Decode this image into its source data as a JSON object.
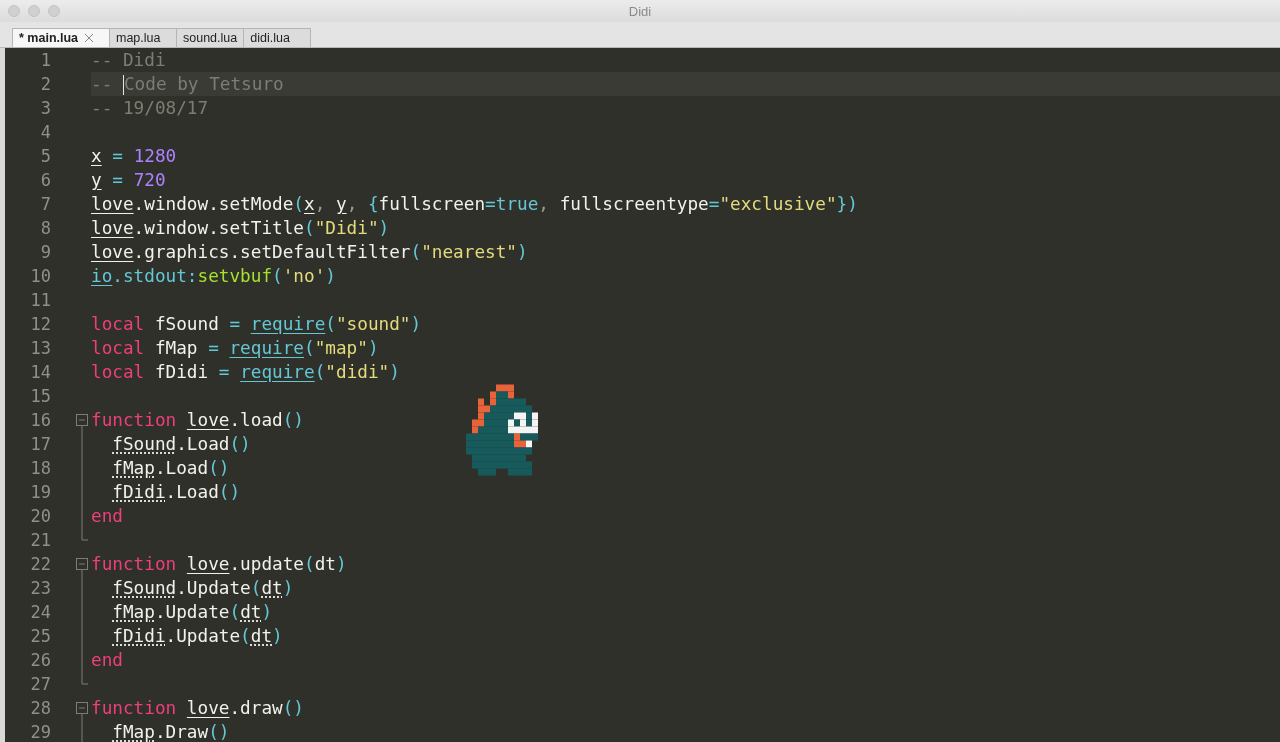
{
  "window": {
    "title": "Didi"
  },
  "tabs": [
    {
      "label": "* main.lua",
      "selected": true
    },
    {
      "label": "map.lua",
      "selected": false
    },
    {
      "label": "sound.lua",
      "selected": false
    },
    {
      "label": "didi.lua",
      "selected": false
    }
  ],
  "lines": [
    {
      "number": "1",
      "tokens": [
        {
          "text": "-- Didi",
          "kind": "comment"
        }
      ]
    },
    {
      "number": "2",
      "current": true,
      "tokens": [
        {
          "text": "-- ",
          "kind": "comment"
        },
        {
          "text": "Code by Tetsuro",
          "kind": "comment",
          "caret_before": true
        }
      ]
    },
    {
      "number": "3",
      "tokens": [
        {
          "text": "-- 19/08/17",
          "kind": "comment"
        }
      ]
    },
    {
      "number": "4"
    },
    {
      "number": "5",
      "tokens": [
        {
          "text": "x",
          "kind": "var"
        },
        {
          "text": " = ",
          "kind": "op"
        },
        {
          "text": "1280",
          "kind": "number"
        }
      ]
    },
    {
      "number": "6",
      "tokens": [
        {
          "text": "y",
          "kind": "var"
        },
        {
          "text": " = ",
          "kind": "op"
        },
        {
          "text": "720",
          "kind": "number"
        }
      ]
    },
    {
      "number": "7",
      "tokens": [
        {
          "text": "love",
          "kind": "var"
        },
        {
          "text": ".window.setMode",
          "kind": "plain"
        },
        {
          "text": "(",
          "kind": "op"
        },
        {
          "text": "x",
          "kind": "var"
        },
        {
          "text": ", ",
          "kind": "punct"
        },
        {
          "text": "y",
          "kind": "var"
        },
        {
          "text": ", ",
          "kind": "punct"
        },
        {
          "text": "{",
          "kind": "op"
        },
        {
          "text": "fullscreen",
          "kind": "plain"
        },
        {
          "text": "=true",
          "kind": "op"
        },
        {
          "text": ", ",
          "kind": "punct"
        },
        {
          "text": "fullscreentype",
          "kind": "plain"
        },
        {
          "text": "=",
          "kind": "op"
        },
        {
          "text": "\"exclusive\"",
          "kind": "string"
        },
        {
          "text": "})",
          "kind": "op"
        }
      ]
    },
    {
      "number": "8",
      "tokens": [
        {
          "text": "love",
          "kind": "var"
        },
        {
          "text": ".window.setTitle",
          "kind": "plain"
        },
        {
          "text": "(",
          "kind": "op"
        },
        {
          "text": "\"Didi\"",
          "kind": "string"
        },
        {
          "text": ")",
          "kind": "op"
        }
      ]
    },
    {
      "number": "9",
      "tokens": [
        {
          "text": "love",
          "kind": "var"
        },
        {
          "text": ".graphics.setDefaultFilter",
          "kind": "plain"
        },
        {
          "text": "(",
          "kind": "op"
        },
        {
          "text": "\"nearest\"",
          "kind": "string"
        },
        {
          "text": ")",
          "kind": "op"
        }
      ]
    },
    {
      "number": "10",
      "tokens": [
        {
          "text": "io",
          "kind": "builtin"
        },
        {
          "text": ".stdout:",
          "kind": "op"
        },
        {
          "text": "setvbuf",
          "kind": "method"
        },
        {
          "text": "(",
          "kind": "op"
        },
        {
          "text": "'no'",
          "kind": "string"
        },
        {
          "text": ")",
          "kind": "op"
        }
      ]
    },
    {
      "number": "11"
    },
    {
      "number": "12",
      "tokens": [
        {
          "text": "local",
          "kind": "keyword"
        },
        {
          "text": " fSound ",
          "kind": "plain"
        },
        {
          "text": "= ",
          "kind": "op"
        },
        {
          "text": "require",
          "kind": "builtin"
        },
        {
          "text": "(",
          "kind": "op"
        },
        {
          "text": "\"sound\"",
          "kind": "string"
        },
        {
          "text": ")",
          "kind": "op"
        }
      ]
    },
    {
      "number": "13",
      "tokens": [
        {
          "text": "local",
          "kind": "keyword"
        },
        {
          "text": " fMap ",
          "kind": "plain"
        },
        {
          "text": "= ",
          "kind": "op"
        },
        {
          "text": "require",
          "kind": "builtin"
        },
        {
          "text": "(",
          "kind": "op"
        },
        {
          "text": "\"map\"",
          "kind": "string"
        },
        {
          "text": ")",
          "kind": "op"
        }
      ]
    },
    {
      "number": "14",
      "tokens": [
        {
          "text": "local",
          "kind": "keyword"
        },
        {
          "text": " fDidi ",
          "kind": "plain"
        },
        {
          "text": "= ",
          "kind": "op"
        },
        {
          "text": "require",
          "kind": "builtin"
        },
        {
          "text": "(",
          "kind": "op"
        },
        {
          "text": "\"didi\"",
          "kind": "string"
        },
        {
          "text": ")",
          "kind": "op"
        }
      ]
    },
    {
      "number": "15"
    },
    {
      "number": "16",
      "fold_start": true,
      "tokens": [
        {
          "text": "function ",
          "kind": "keyword"
        },
        {
          "text": "love",
          "kind": "var"
        },
        {
          "text": ".load",
          "kind": "plain"
        },
        {
          "text": "()",
          "kind": "op"
        }
      ]
    },
    {
      "number": "17",
      "fold_guide": true,
      "tokens": [
        {
          "text": "  fSound",
          "kind": "module"
        },
        {
          "text": ".Load",
          "kind": "plain"
        },
        {
          "text": "()",
          "kind": "op"
        }
      ]
    },
    {
      "number": "18",
      "fold_guide": true,
      "tokens": [
        {
          "text": "  fMap",
          "kind": "module"
        },
        {
          "text": ".Load",
          "kind": "plain"
        },
        {
          "text": "()",
          "kind": "op"
        }
      ]
    },
    {
      "number": "19",
      "fold_guide": true,
      "tokens": [
        {
          "text": "  fDidi",
          "kind": "module"
        },
        {
          "text": ".Load",
          "kind": "plain"
        },
        {
          "text": "()",
          "kind": "op"
        }
      ]
    },
    {
      "number": "20",
      "fold_guide": true,
      "tokens": [
        {
          "text": "end",
          "kind": "keyword"
        }
      ]
    },
    {
      "number": "21",
      "fold_end": true
    },
    {
      "number": "22",
      "fold_start": true,
      "tokens": [
        {
          "text": "function ",
          "kind": "keyword"
        },
        {
          "text": "love",
          "kind": "var"
        },
        {
          "text": ".update",
          "kind": "plain"
        },
        {
          "text": "(",
          "kind": "op"
        },
        {
          "text": "dt",
          "kind": "plain"
        },
        {
          "text": ")",
          "kind": "op"
        }
      ]
    },
    {
      "number": "23",
      "fold_guide": true,
      "tokens": [
        {
          "text": "  fSound",
          "kind": "module"
        },
        {
          "text": ".Update",
          "kind": "plain"
        },
        {
          "text": "(",
          "kind": "op"
        },
        {
          "text": "dt",
          "kind": "module"
        },
        {
          "text": ")",
          "kind": "op"
        }
      ]
    },
    {
      "number": "24",
      "fold_guide": true,
      "tokens": [
        {
          "text": "  fMap",
          "kind": "module"
        },
        {
          "text": ".Update",
          "kind": "plain"
        },
        {
          "text": "(",
          "kind": "op"
        },
        {
          "text": "dt",
          "kind": "module"
        },
        {
          "text": ")",
          "kind": "op"
        }
      ]
    },
    {
      "number": "25",
      "fold_guide": true,
      "tokens": [
        {
          "text": "  fDidi",
          "kind": "module"
        },
        {
          "text": ".Update",
          "kind": "plain"
        },
        {
          "text": "(",
          "kind": "op"
        },
        {
          "text": "dt",
          "kind": "module"
        },
        {
          "text": ")",
          "kind": "op"
        }
      ]
    },
    {
      "number": "26",
      "fold_guide": true,
      "tokens": [
        {
          "text": "end",
          "kind": "keyword"
        }
      ]
    },
    {
      "number": "27",
      "fold_end": true
    },
    {
      "number": "28",
      "fold_start": true,
      "tokens": [
        {
          "text": "function ",
          "kind": "keyword"
        },
        {
          "text": "love",
          "kind": "var"
        },
        {
          "text": ".draw",
          "kind": "plain"
        },
        {
          "text": "()",
          "kind": "op"
        }
      ]
    },
    {
      "number": "29",
      "fold_guide": true,
      "tokens": [
        {
          "text": "  fMap",
          "kind": "module"
        },
        {
          "text": ".Draw",
          "kind": "plain"
        },
        {
          "text": "()",
          "kind": "op"
        }
      ]
    }
  ]
}
